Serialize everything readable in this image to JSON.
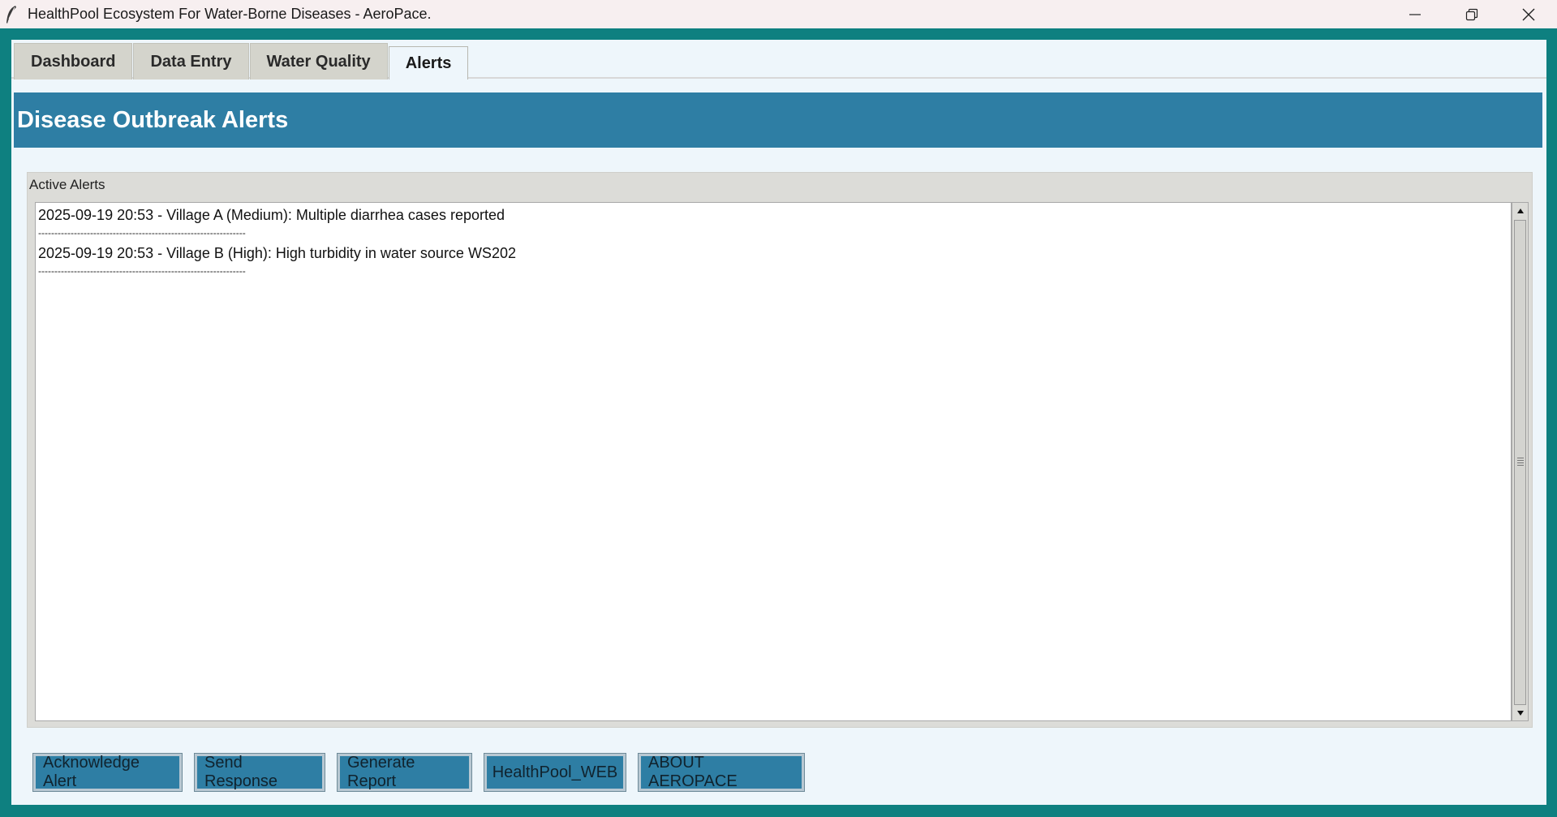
{
  "window": {
    "title": "HealthPool Ecosystem For Water-Borne Diseases - AeroPace.",
    "app_icon": "feather-icon",
    "controls": [
      "minimize-icon",
      "restore-icon",
      "close-icon"
    ]
  },
  "tabs": [
    {
      "label": "Dashboard",
      "active": false
    },
    {
      "label": "Data Entry",
      "active": false
    },
    {
      "label": "Water Quality",
      "active": false
    },
    {
      "label": "Alerts",
      "active": true
    }
  ],
  "header": {
    "title": "Disease Outbreak Alerts",
    "color": "#2e7ea4"
  },
  "alerts_panel": {
    "label": "Active Alerts",
    "entries": [
      {
        "text": "2025-09-19 20:53 - Village A (Medium): Multiple diarrhea cases reported",
        "separator": "----------------------------------------------------------------"
      },
      {
        "text": "2025-09-19 20:53 - Village B (High): High turbidity in water source WS202",
        "separator": "----------------------------------------------------------------"
      }
    ]
  },
  "actions": {
    "acknowledge": "Acknowledge Alert",
    "send_response": "Send Response",
    "generate_report": "Generate Report",
    "healthpool_web": "HealthPool_WEB",
    "about": "ABOUT AEROPACE"
  },
  "colors": {
    "window_frame": "#0e8080",
    "accent": "#2e7ea4",
    "body": "#eef6fb"
  }
}
